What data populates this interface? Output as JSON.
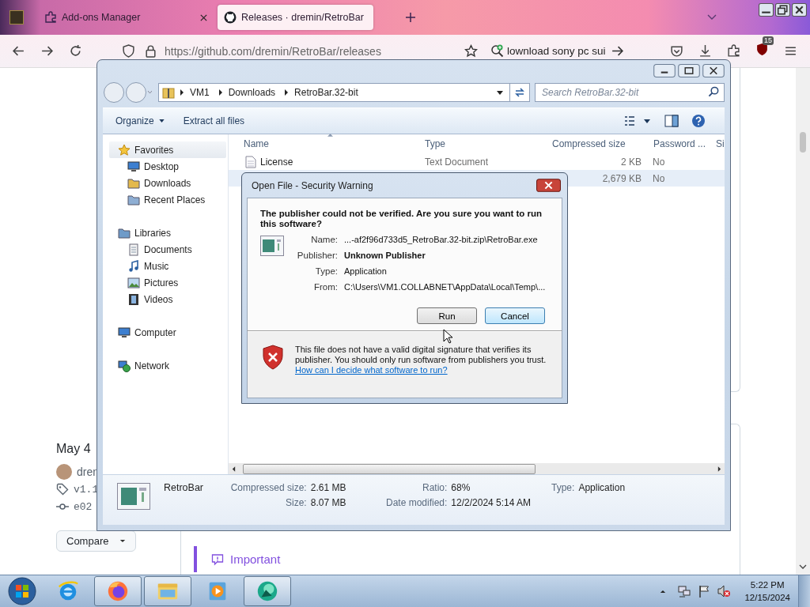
{
  "browser": {
    "tabs": [
      {
        "label": "Add-ons Manager",
        "kind": "addons",
        "selected": false
      },
      {
        "label": "Releases · dremin/RetroBar",
        "kind": "github",
        "selected": true
      }
    ],
    "url": "https://github.com/dremin/RetroBar/releases",
    "search_text": "lownload sony pc sui",
    "addon_badge": "15"
  },
  "page": {
    "date": "May 4",
    "author": "dren",
    "tag": "v1.1",
    "commit": "e02",
    "compare": "Compare",
    "callout": "Important"
  },
  "explorer": {
    "breadcrumb": [
      "VM1",
      "Downloads",
      "RetroBar.32-bit"
    ],
    "search": {
      "placeholder": "Search RetroBar.32-bit"
    },
    "commands": [
      {
        "label": "Organize",
        "dropdown": true
      },
      {
        "label": "Extract all files",
        "dropdown": false
      }
    ],
    "nav": [
      {
        "label": "Favorites",
        "kind": "star",
        "selected": true,
        "children": [
          {
            "label": "Desktop",
            "kind": "desktop",
            "selected": false
          },
          {
            "label": "Downloads",
            "kind": "downloads",
            "selected": false
          },
          {
            "label": "Recent Places",
            "kind": "recent",
            "selected": false
          }
        ]
      },
      {
        "label": "Libraries",
        "kind": "library",
        "selected": false,
        "children": [
          {
            "label": "Documents",
            "kind": "documents",
            "selected": false
          },
          {
            "label": "Music",
            "kind": "music",
            "selected": false
          },
          {
            "label": "Pictures",
            "kind": "pictures",
            "selected": false
          },
          {
            "label": "Videos",
            "kind": "videos",
            "selected": false
          }
        ]
      },
      {
        "label": "Computer",
        "kind": "computer",
        "selected": false
      },
      {
        "label": "Network",
        "kind": "network",
        "selected": false
      }
    ],
    "columns": [
      "Name",
      "Type",
      "Compressed size",
      "Password ...",
      "Si"
    ],
    "files": [
      {
        "name": "License",
        "type": "Text Document",
        "compressed_size": "2 KB",
        "password": "No",
        "selected": false
      },
      {
        "compressed_size": "2,679 KB",
        "password": "No",
        "selected": true
      }
    ],
    "details": {
      "name": "RetroBar",
      "columns": [
        [
          {
            "label": "Compressed size:",
            "value": "2.61 MB"
          },
          {
            "label": "Size:",
            "value": "8.07 MB"
          }
        ],
        [
          {
            "label": "Ratio:",
            "value": "68%"
          },
          {
            "label": "Date modified:",
            "value": "12/2/2024 5:14 AM"
          }
        ],
        [
          {
            "label": "Type:",
            "value": "Application"
          }
        ]
      ]
    }
  },
  "dialog": {
    "title": "Open File - Security Warning",
    "heading": "The publisher could not be verified.  Are you sure you want to run this software?",
    "fields": [
      {
        "label": "Name:",
        "value": "...-af2f96d733d5_RetroBar.32-bit.zip\\RetroBar.exe",
        "bold": false
      },
      {
        "label": "Publisher:",
        "value": "Unknown Publisher",
        "bold": true
      },
      {
        "label": "Type:",
        "value": "Application",
        "bold": false
      },
      {
        "label": "From:",
        "value": "C:\\Users\\VM1.COLLABNET\\AppData\\Local\\Temp\\...",
        "bold": false
      }
    ],
    "buttons": [
      {
        "label": "Run",
        "default": false
      },
      {
        "label": "Cancel",
        "default": true
      }
    ],
    "warning": "This file does not have a valid digital signature that verifies its publisher.  You should only run software from publishers you trust.",
    "link": "How can I decide what software to run?"
  },
  "taskbar": {
    "apps": [
      {
        "kind": "ie",
        "running": false
      },
      {
        "kind": "firefox",
        "running": true
      },
      {
        "kind": "explorer",
        "running": true
      },
      {
        "kind": "media",
        "running": false
      },
      {
        "kind": "green",
        "running": true
      }
    ],
    "time": "5:22 PM",
    "date": "12/15/2024"
  }
}
